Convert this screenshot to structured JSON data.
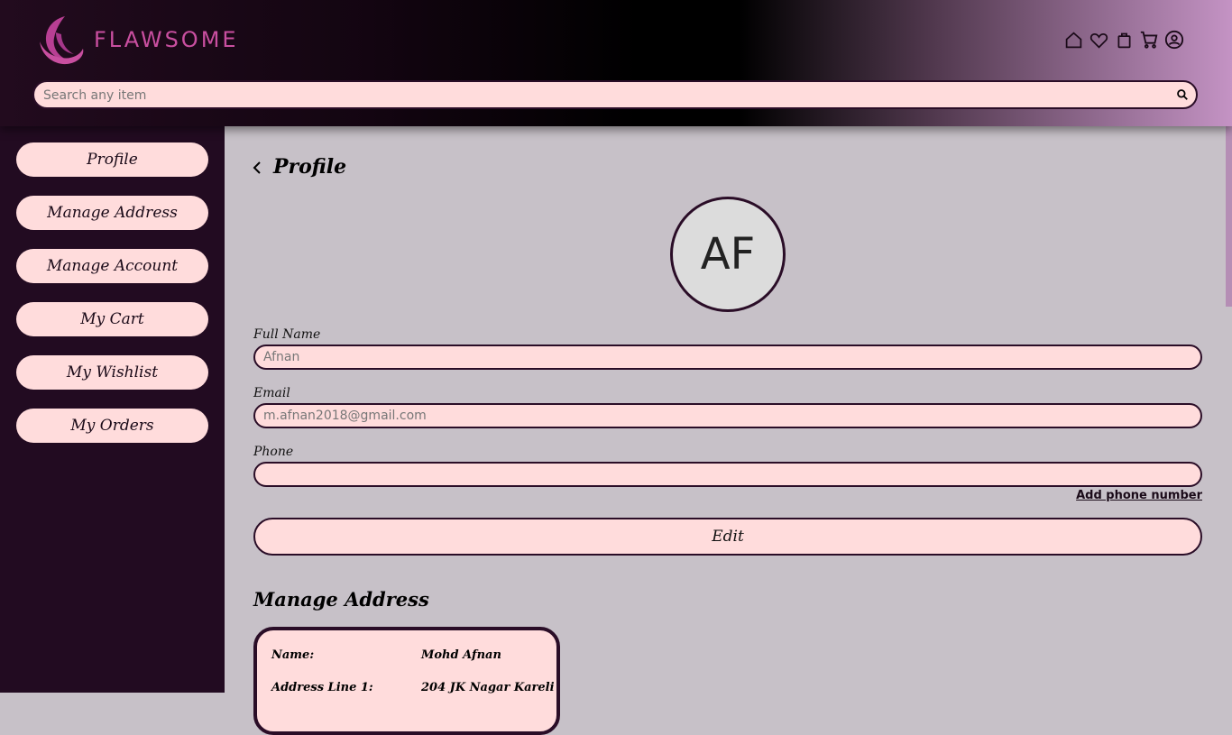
{
  "header": {
    "brand": "FLAWSOME",
    "search_placeholder": "Search any item",
    "icons": [
      "home-icon",
      "heart-icon",
      "shopping-bag-icon",
      "cart-icon",
      "account-icon"
    ]
  },
  "sidebar": {
    "items": [
      {
        "label": "Profile"
      },
      {
        "label": "Manage Address"
      },
      {
        "label": "Manage Account"
      },
      {
        "label": "My Cart"
      },
      {
        "label": "My Wishlist"
      },
      {
        "label": "My Orders"
      }
    ]
  },
  "profile": {
    "title": "Profile",
    "avatar_initials": "AF",
    "full_name_label": "Full Name",
    "full_name_value": "Afnan",
    "email_label": "Email",
    "email_value": "m.afnan2018@gmail.com",
    "phone_label": "Phone",
    "phone_value": "",
    "add_phone_link": "Add phone number",
    "edit_button": "Edit"
  },
  "address": {
    "title": "Manage Address",
    "rows": [
      {
        "key": "Name:",
        "value": "Mohd Afnan"
      },
      {
        "key": "Address Line 1:",
        "value": "204 JK Nagar Kareli"
      }
    ]
  },
  "colors": {
    "accent": "#c94fa0",
    "field_bg": "#ffdcdc",
    "sidebar_bg": "#220b21",
    "main_bg": "#c7c1c8",
    "border": "#2a0d27"
  }
}
